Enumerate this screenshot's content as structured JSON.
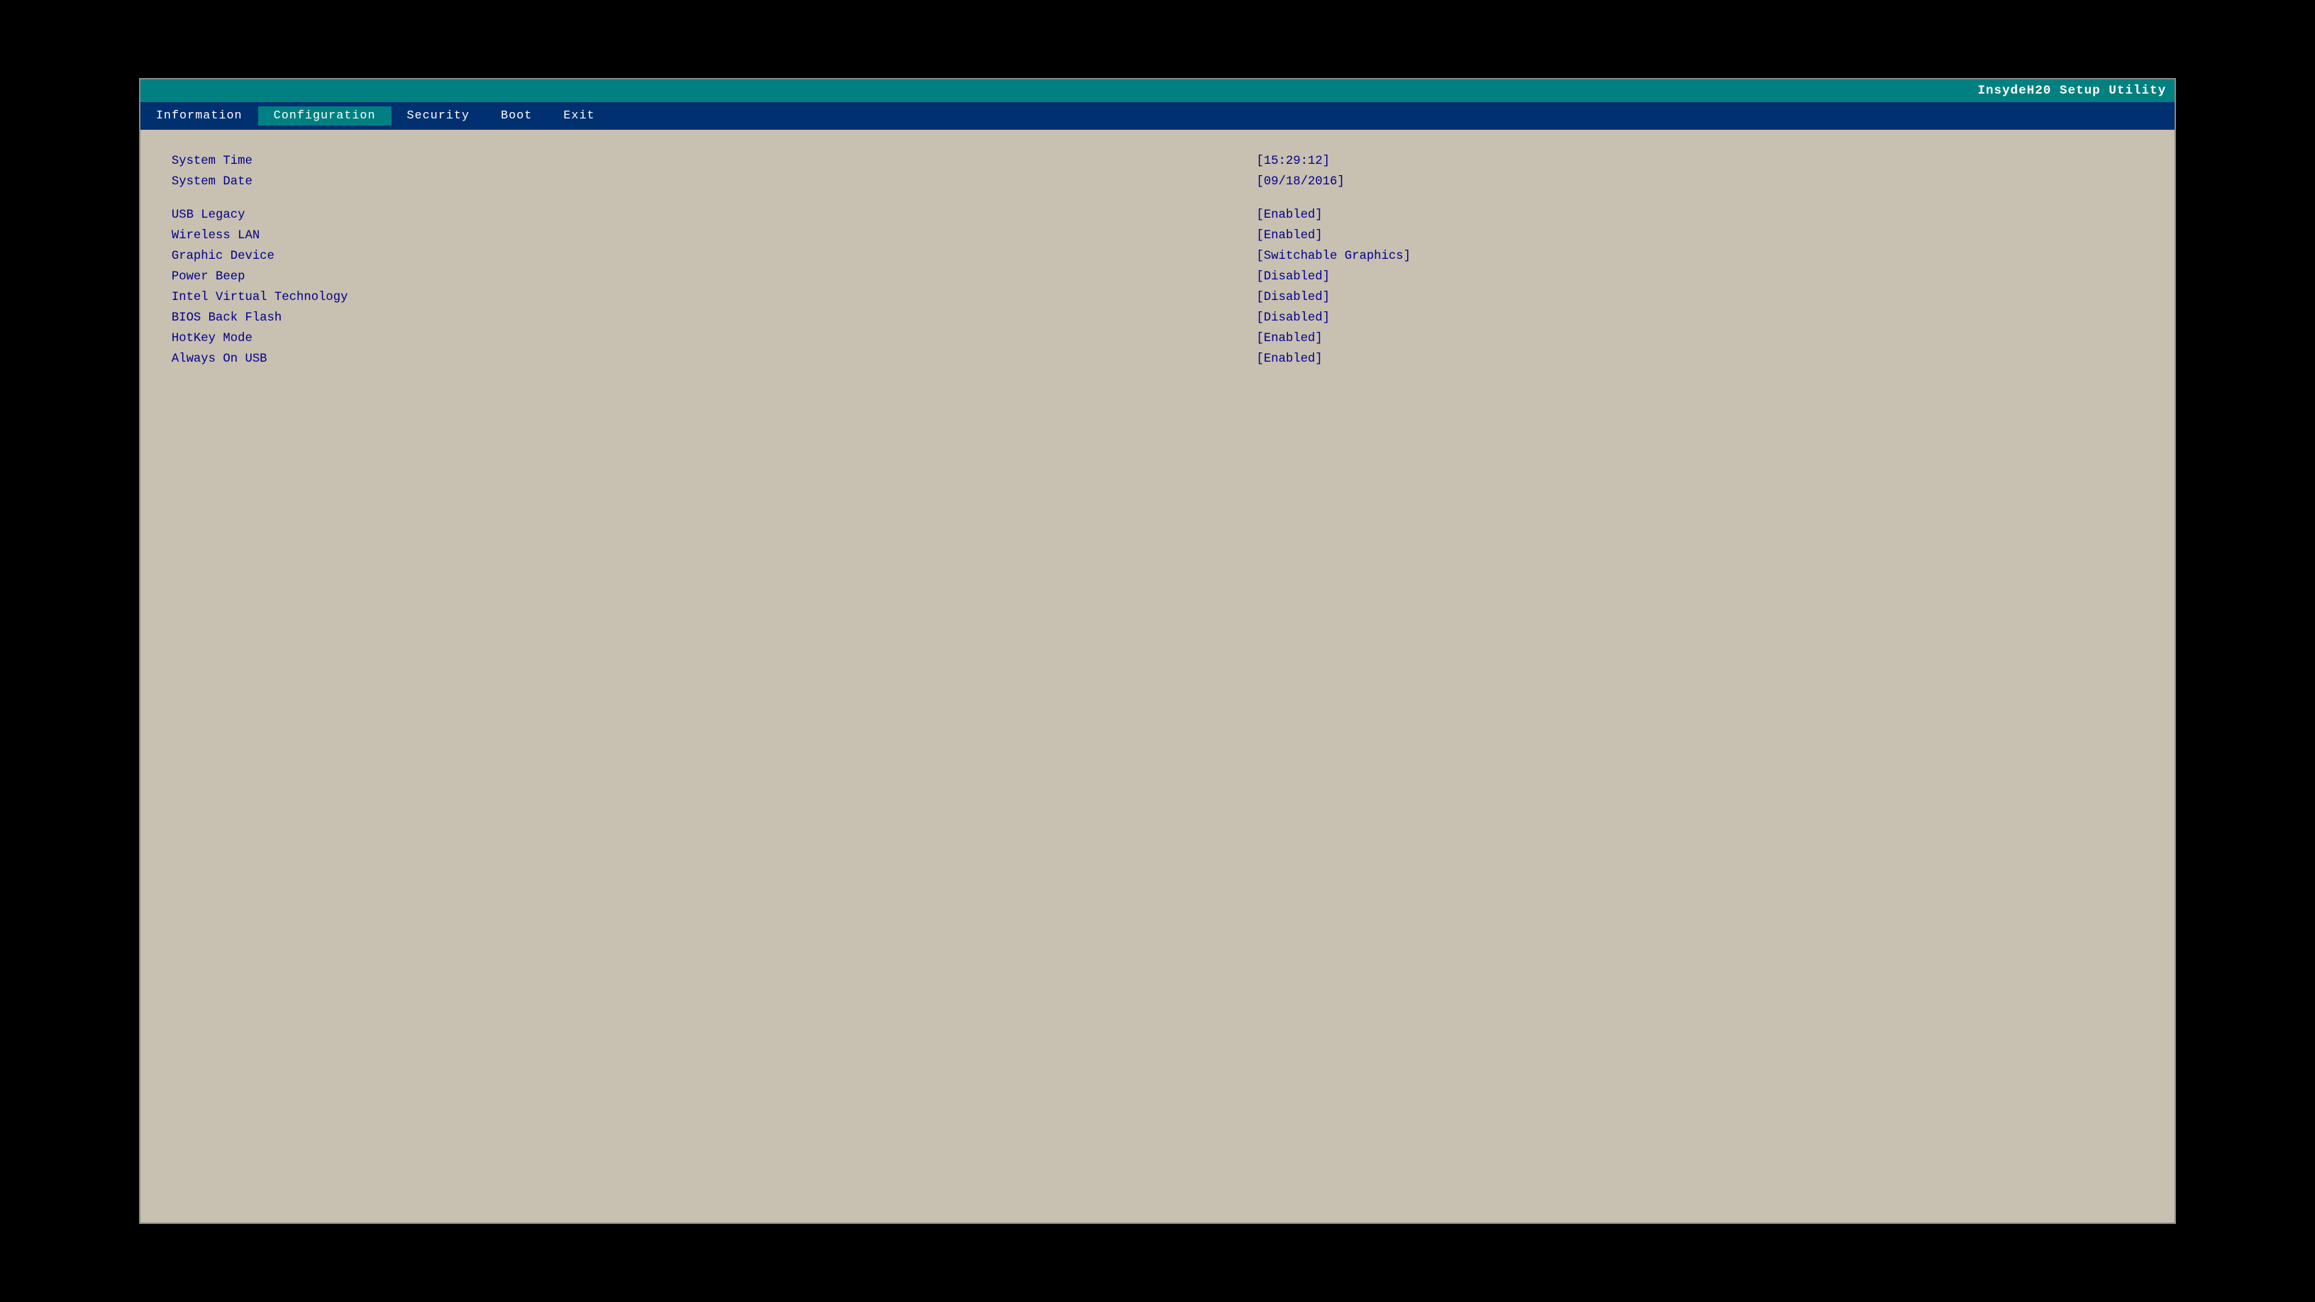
{
  "title_bar": {
    "utility_name": "InsydeH20 Setup Utility"
  },
  "menu": {
    "items": [
      {
        "label": "Information",
        "active": false
      },
      {
        "label": "Configuration",
        "active": true
      },
      {
        "label": "Security",
        "active": false
      },
      {
        "label": "Boot",
        "active": false
      },
      {
        "label": "Exit",
        "active": false
      }
    ]
  },
  "settings": [
    {
      "label": "System Time",
      "value": "[15:29:12]",
      "spacer_before": false
    },
    {
      "label": "System Date",
      "value": "[09/18/2016]",
      "spacer_before": false
    },
    {
      "label": "",
      "value": "",
      "spacer": true
    },
    {
      "label": "USB Legacy",
      "value": "[Enabled]",
      "spacer_before": false
    },
    {
      "label": "Wireless LAN",
      "value": "[Enabled]",
      "spacer_before": false
    },
    {
      "label": "Graphic Device",
      "value": "[Switchable Graphics]",
      "spacer_before": false
    },
    {
      "label": "Power Beep",
      "value": "[Disabled]",
      "spacer_before": false
    },
    {
      "label": "Intel Virtual Technology",
      "value": "[Disabled]",
      "spacer_before": false
    },
    {
      "label": "BIOS Back Flash",
      "value": "[Disabled]",
      "spacer_before": false
    },
    {
      "label": "HotKey Mode",
      "value": "[Enabled]",
      "spacer_before": false
    },
    {
      "label": "Always On USB",
      "value": "[Enabled]",
      "spacer_before": false
    }
  ]
}
